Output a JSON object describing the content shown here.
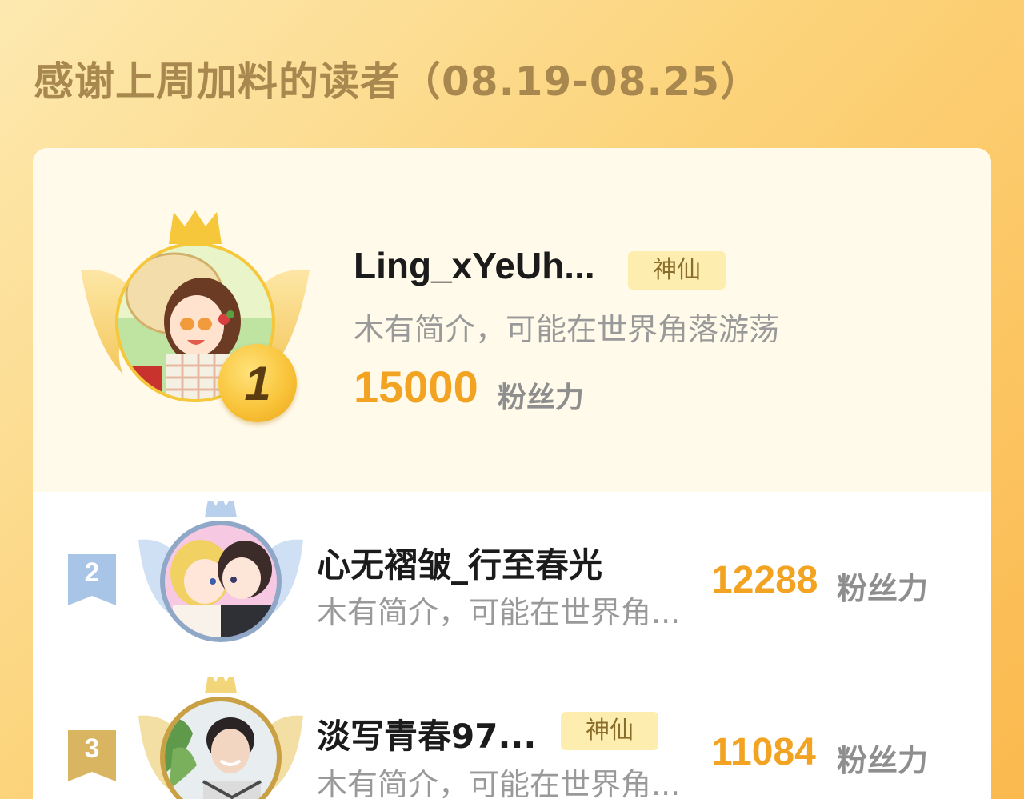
{
  "page": {
    "title": "感谢上周加料的读者（08.19-08.25）"
  },
  "colors": {
    "background_start": "#fde9b0",
    "background_end": "#fbb94e",
    "title": "#a8884f",
    "score": "#f2a322",
    "badge_bg": "#fdeeb0",
    "rank1": "#f9c43a",
    "rank2": "#a8c4e6",
    "rank3": "#d9b562"
  },
  "readers": [
    {
      "rank": "1",
      "name": "Ling_xYeUh...",
      "badge": "神仙",
      "bio": "木有简介，可能在世界角落游荡",
      "score": "15000",
      "score_unit": "粉丝力",
      "avatar_icon": "anime-girl-straw-hat-avatar"
    },
    {
      "rank": "2",
      "name": "心无褶皱_行至春光",
      "badge": "",
      "bio": "木有简介，可能在世界角...",
      "score": "12288",
      "score_unit": "粉丝力",
      "avatar_icon": "anime-couple-avatar"
    },
    {
      "rank": "3",
      "name": "淡写青春97...",
      "badge": "神仙",
      "bio": "木有简介，可能在世界角...",
      "score": "11084",
      "score_unit": "粉丝力",
      "avatar_icon": "smiling-man-photo-avatar"
    }
  ]
}
